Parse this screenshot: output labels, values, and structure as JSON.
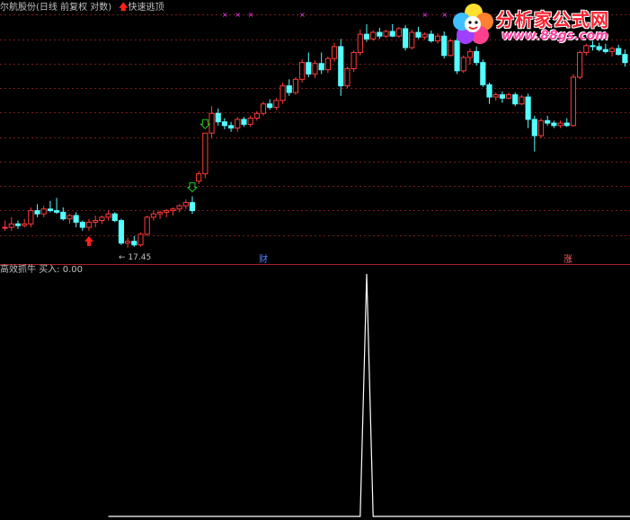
{
  "header": {
    "stock_label": "尔航股份(日线 前复权 对数)",
    "arrow_glyph": "🡅",
    "signal_label": "快速逃顶"
  },
  "indicator": {
    "label": "高效抓牛",
    "buy_label": "买入: 0.00"
  },
  "annotations": {
    "low_price": "← 17.45",
    "marker_cai": "财",
    "marker_zhang": "涨"
  },
  "logo": {
    "name": "分析家公式网",
    "url": "www.88gs.com"
  },
  "colors": {
    "up": "#ff3b3b",
    "down": "#54ffff",
    "grid": "#7a1a1a",
    "background": "#000000",
    "line": "#ffffff",
    "buy_arrow": "#ff2020",
    "top_arrow": "#22cc22",
    "top_marker": "#ff40ff"
  },
  "chart_data": [
    {
      "type": "candlestick",
      "title": "",
      "candles": [
        [
          18.6,
          19.0,
          18.4,
          18.6
        ],
        [
          18.6,
          19.2,
          18.4,
          18.8
        ],
        [
          18.8,
          19.0,
          18.5,
          18.7
        ],
        [
          18.7,
          19.1,
          18.6,
          18.8
        ],
        [
          18.8,
          19.8,
          18.6,
          19.6
        ],
        [
          19.6,
          20.0,
          19.2,
          19.4
        ],
        [
          19.4,
          19.9,
          19.2,
          19.7
        ],
        [
          19.7,
          20.2,
          19.5,
          19.6
        ],
        [
          19.6,
          20.4,
          19.4,
          19.5
        ],
        [
          19.5,
          19.8,
          19.0,
          19.1
        ],
        [
          19.1,
          19.4,
          18.8,
          19.3
        ],
        [
          19.3,
          19.5,
          18.6,
          18.9
        ],
        [
          18.9,
          19.0,
          18.4,
          18.6
        ],
        [
          18.6,
          19.1,
          18.4,
          18.9
        ],
        [
          18.9,
          19.3,
          18.6,
          19.0
        ],
        [
          19.0,
          19.3,
          18.8,
          19.2
        ],
        [
          19.2,
          19.6,
          19.0,
          19.4
        ],
        [
          19.4,
          19.5,
          18.9,
          19.0
        ],
        [
          19.0,
          19.1,
          17.6,
          17.7
        ],
        [
          17.7,
          18.0,
          17.45,
          17.8
        ],
        [
          17.8,
          18.1,
          17.5,
          17.6
        ],
        [
          17.6,
          18.3,
          17.5,
          18.2
        ],
        [
          18.2,
          19.3,
          18.1,
          19.2
        ],
        [
          19.2,
          19.6,
          19.0,
          19.4
        ],
        [
          19.4,
          19.6,
          19.1,
          19.5
        ],
        [
          19.5,
          19.7,
          19.2,
          19.6
        ],
        [
          19.6,
          19.8,
          19.3,
          19.7
        ],
        [
          19.7,
          20.0,
          19.5,
          19.9
        ],
        [
          19.9,
          20.3,
          19.7,
          20.1
        ],
        [
          20.1,
          20.5,
          19.4,
          19.6
        ],
        [
          21.5,
          22.2,
          21.3,
          22.0
        ],
        [
          22.0,
          25.0,
          21.7,
          25.0
        ],
        [
          25.0,
          27.2,
          24.6,
          26.6
        ],
        [
          26.6,
          27.0,
          25.6,
          25.9
        ],
        [
          25.9,
          26.2,
          25.3,
          25.6
        ],
        [
          25.6,
          25.9,
          25.1,
          25.4
        ],
        [
          25.4,
          26.3,
          25.1,
          26.1
        ],
        [
          26.1,
          26.3,
          25.5,
          25.7
        ],
        [
          25.7,
          26.4,
          25.5,
          26.2
        ],
        [
          26.2,
          26.8,
          26.0,
          26.6
        ],
        [
          26.6,
          27.6,
          26.4,
          27.4
        ],
        [
          27.4,
          27.8,
          26.9,
          27.1
        ],
        [
          27.1,
          27.9,
          26.9,
          27.7
        ],
        [
          27.7,
          29.3,
          27.4,
          29.0
        ],
        [
          29.0,
          29.6,
          28.1,
          28.4
        ],
        [
          28.4,
          29.8,
          28.2,
          29.6
        ],
        [
          29.6,
          31.5,
          29.3,
          31.2
        ],
        [
          31.2,
          32.2,
          29.8,
          30.1
        ],
        [
          30.1,
          31.4,
          29.7,
          31.1
        ],
        [
          31.1,
          32.2,
          30.1,
          30.5
        ],
        [
          30.5,
          31.8,
          30.2,
          31.6
        ],
        [
          31.6,
          33.2,
          31.3,
          32.8
        ],
        [
          32.8,
          33.6,
          28.1,
          29.0
        ],
        [
          29.0,
          30.8,
          28.8,
          30.6
        ],
        [
          30.6,
          32.4,
          30.3,
          32.2
        ],
        [
          32.2,
          34.6,
          31.9,
          34.1
        ],
        [
          34.1,
          35.2,
          33.3,
          33.6
        ],
        [
          33.6,
          34.5,
          33.4,
          34.3
        ],
        [
          34.3,
          34.8,
          33.6,
          33.9
        ],
        [
          33.9,
          34.6,
          33.7,
          34.4
        ],
        [
          34.4,
          35.2,
          33.8,
          33.9
        ],
        [
          33.9,
          34.9,
          33.7,
          34.7
        ],
        [
          34.7,
          35.1,
          32.4,
          32.7
        ],
        [
          32.7,
          34.6,
          32.5,
          34.3
        ],
        [
          34.3,
          34.9,
          33.6,
          33.8
        ],
        [
          33.8,
          34.3,
          33.5,
          34.1
        ],
        [
          34.1,
          34.5,
          33.2,
          33.4
        ],
        [
          33.4,
          34.2,
          33.1,
          33.9
        ],
        [
          33.9,
          34.4,
          31.6,
          31.9
        ],
        [
          31.9,
          33.6,
          31.8,
          33.4
        ],
        [
          33.4,
          33.7,
          30.1,
          30.4
        ],
        [
          30.4,
          31.9,
          30.2,
          31.7
        ],
        [
          31.7,
          32.6,
          31.0,
          32.3
        ],
        [
          32.3,
          32.8,
          30.9,
          31.2
        ],
        [
          31.2,
          31.5,
          28.9,
          29.1
        ],
        [
          29.1,
          29.3,
          27.4,
          28.0
        ],
        [
          28.0,
          28.4,
          27.7,
          28.2
        ],
        [
          28.2,
          28.5,
          27.5,
          27.9
        ],
        [
          27.9,
          28.4,
          27.8,
          28.2
        ],
        [
          28.2,
          28.4,
          27.2,
          27.4
        ],
        [
          27.4,
          28.2,
          27.3,
          28.0
        ],
        [
          28.0,
          28.3,
          25.4,
          26.1
        ],
        [
          26.1,
          26.4,
          23.6,
          24.8
        ],
        [
          24.8,
          26.2,
          24.6,
          26.0
        ],
        [
          26.0,
          26.4,
          25.6,
          25.8
        ],
        [
          25.8,
          26.0,
          25.4,
          25.6
        ],
        [
          25.6,
          26.0,
          25.4,
          25.8
        ],
        [
          25.8,
          26.2,
          25.5,
          25.6
        ],
        [
          25.6,
          30.1,
          25.5,
          29.8
        ],
        [
          29.8,
          32.4,
          29.6,
          32.2
        ],
        [
          32.2,
          33.1,
          31.9,
          32.9
        ],
        [
          32.9,
          33.4,
          32.4,
          32.8
        ],
        [
          32.8,
          33.2,
          32.3,
          32.5
        ],
        [
          32.5,
          33.1,
          32.1,
          32.3
        ],
        [
          32.3,
          32.8,
          31.8,
          32.6
        ],
        [
          32.6,
          33.0,
          31.9,
          32.0
        ],
        [
          32.0,
          32.5,
          30.8,
          31.2
        ]
      ],
      "low_label_value": 17.45
    },
    {
      "type": "line",
      "title": "高效抓牛",
      "values": [
        0,
        0,
        0,
        0,
        0,
        0,
        0,
        0,
        0,
        0,
        0,
        0,
        0,
        0,
        0,
        0,
        0,
        0,
        0,
        0,
        0,
        0,
        0,
        0,
        0,
        0,
        0,
        0,
        0,
        0,
        0,
        0,
        0,
        0,
        0,
        0,
        0,
        0,
        0,
        0,
        1,
        0,
        0,
        0,
        0,
        0,
        0,
        0,
        0,
        0,
        0,
        0,
        0,
        0,
        0,
        0,
        0,
        0,
        0,
        0,
        0,
        0,
        0,
        0,
        0,
        0,
        0,
        0,
        0,
        0,
        0,
        0,
        0,
        0,
        0,
        0,
        0,
        0,
        0,
        0,
        0,
        0,
        0,
        0,
        0,
        0,
        0,
        0,
        0,
        0,
        0,
        0,
        0,
        0,
        0,
        0,
        0,
        0
      ],
      "ylim": [
        0,
        1
      ]
    }
  ]
}
